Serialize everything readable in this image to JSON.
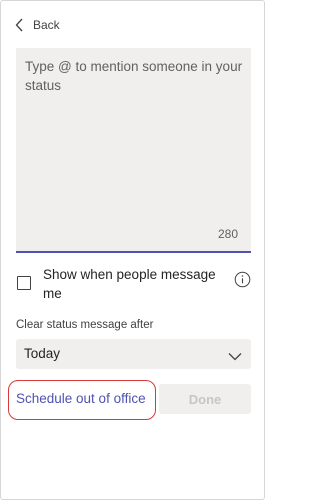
{
  "header": {
    "back_label": "Back"
  },
  "status_message": {
    "placeholder": "Type @ to mention someone in your status",
    "char_counter": "280"
  },
  "show_when_message": {
    "label": "Show when people message me",
    "checked": false
  },
  "clear_after": {
    "label": "Clear status message after",
    "selected_value": "Today"
  },
  "actions": {
    "schedule_label": "Schedule out of office",
    "done_label": "Done"
  },
  "colors": {
    "accent": "#4f52b2",
    "highlight": "#d63a3a",
    "field_bg": "#f0efee",
    "disabled_text": "#c8c6c4"
  },
  "icons": {
    "back": "chevron-left-icon",
    "info": "info-icon",
    "dropdown": "chevron-down-icon"
  }
}
